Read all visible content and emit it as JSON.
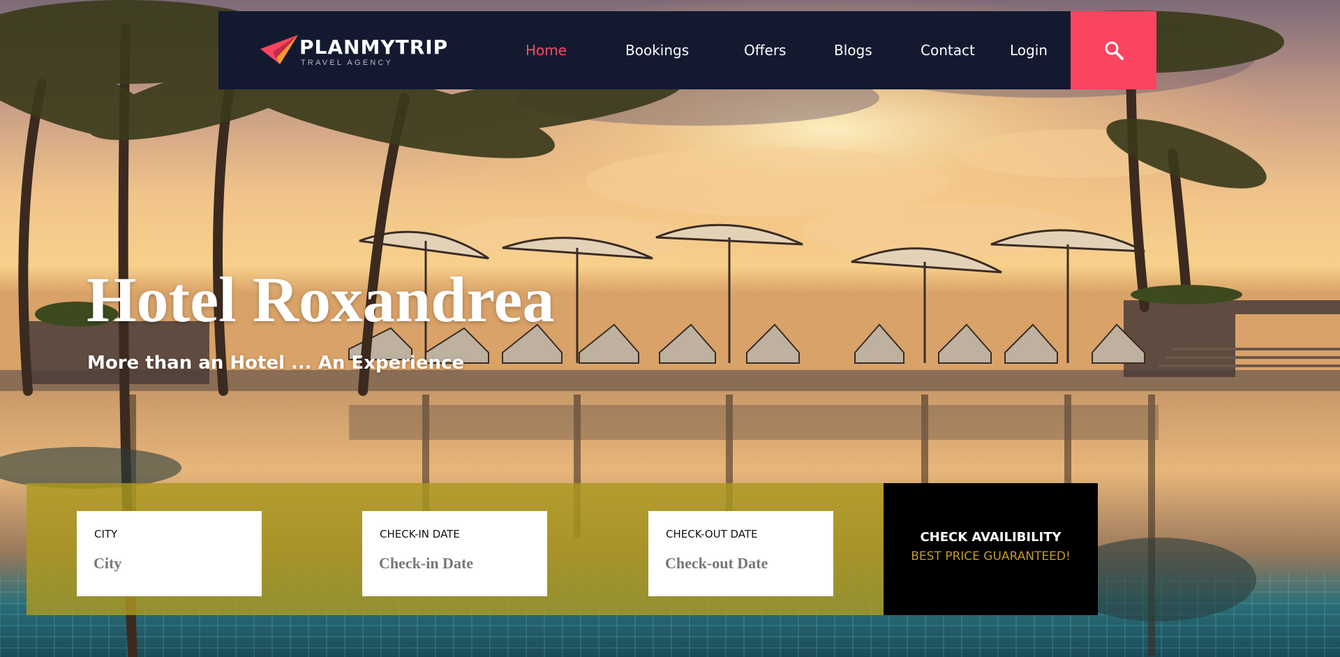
{
  "brand": {
    "name": "PLANMYTRIP",
    "tagline": "TRAVEL AGENCY"
  },
  "nav": {
    "items": [
      {
        "label": "Home",
        "active": true
      },
      {
        "label": "Bookings",
        "active": false
      },
      {
        "label": "Offers",
        "active": false
      },
      {
        "label": "Blogs",
        "active": false
      },
      {
        "label": "Contact",
        "active": false
      },
      {
        "label": "Login",
        "active": false
      }
    ],
    "search_icon": "search-icon"
  },
  "hero": {
    "title": "Hotel Roxandrea",
    "subtitle": "More than an Hotel ... An Experience"
  },
  "booking": {
    "fields": [
      {
        "label": "CITY",
        "placeholder": "City"
      },
      {
        "label": "CHECK-IN DATE",
        "placeholder": "Check-in Date"
      },
      {
        "label": "CHECK-OUT DATE",
        "placeholder": "Check-out Date"
      }
    ],
    "cta_main": "CHECK AVAILIBILITY",
    "cta_sub": "BEST PRICE GUARANTEED!"
  },
  "colors": {
    "nav_bg": "#131a30",
    "accent": "#fb4460",
    "booking_bar": "#ac981e",
    "cta_sub": "#c29b2c"
  }
}
